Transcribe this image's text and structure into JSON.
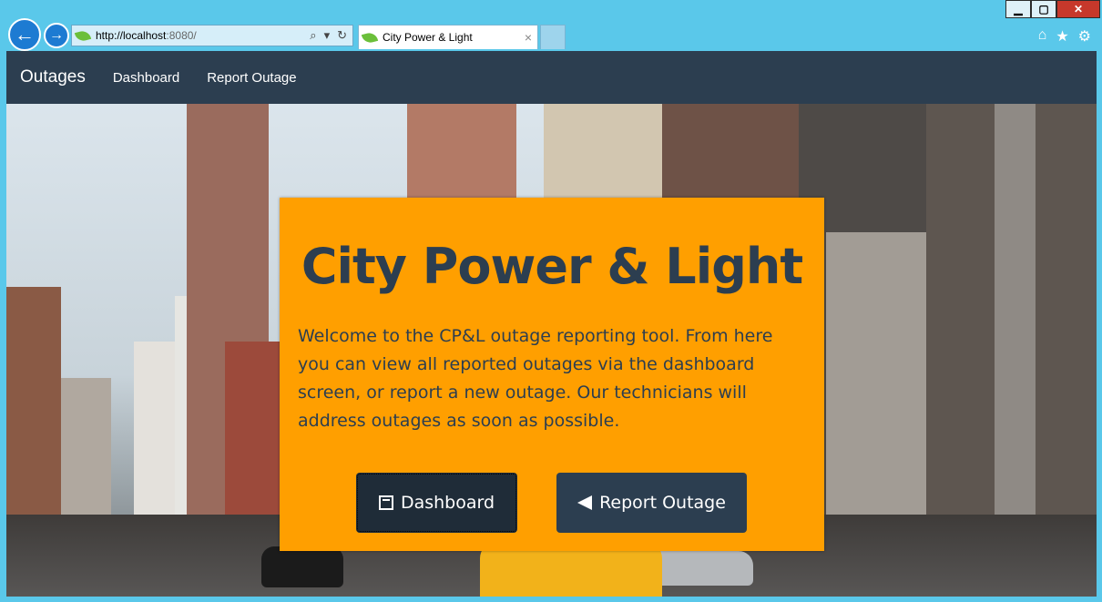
{
  "browser": {
    "url_host": "http://localhost",
    "url_rest": ":8080/",
    "tab_title": "City Power & Light",
    "tab_close": "×",
    "search_glyph": "⌕",
    "dropdown_glyph": "▾",
    "refresh_glyph": "↻",
    "back_glyph": "←",
    "forward_glyph": "→",
    "home_glyph": "⌂",
    "favorites_glyph": "★",
    "settings_glyph": "⚙",
    "minimize_glyph": "▁",
    "maximize_glyph": "▢",
    "close_glyph": "✕"
  },
  "navbar": {
    "brand": "Outages",
    "links": [
      "Dashboard",
      "Report Outage"
    ]
  },
  "hero": {
    "title": "City Power & Light",
    "text": "Welcome to the CP&L outage reporting tool. From here you can view all reported outages via the dashboard screen, or report a new outage. Our technicians will address outages as soon as possible.",
    "buttons": {
      "dashboard": "Dashboard",
      "report": "Report Outage"
    }
  },
  "colors": {
    "navbar": "#2c3e50",
    "jumbotron": "#ff9f00",
    "browser_frame": "#5ac8ea"
  }
}
